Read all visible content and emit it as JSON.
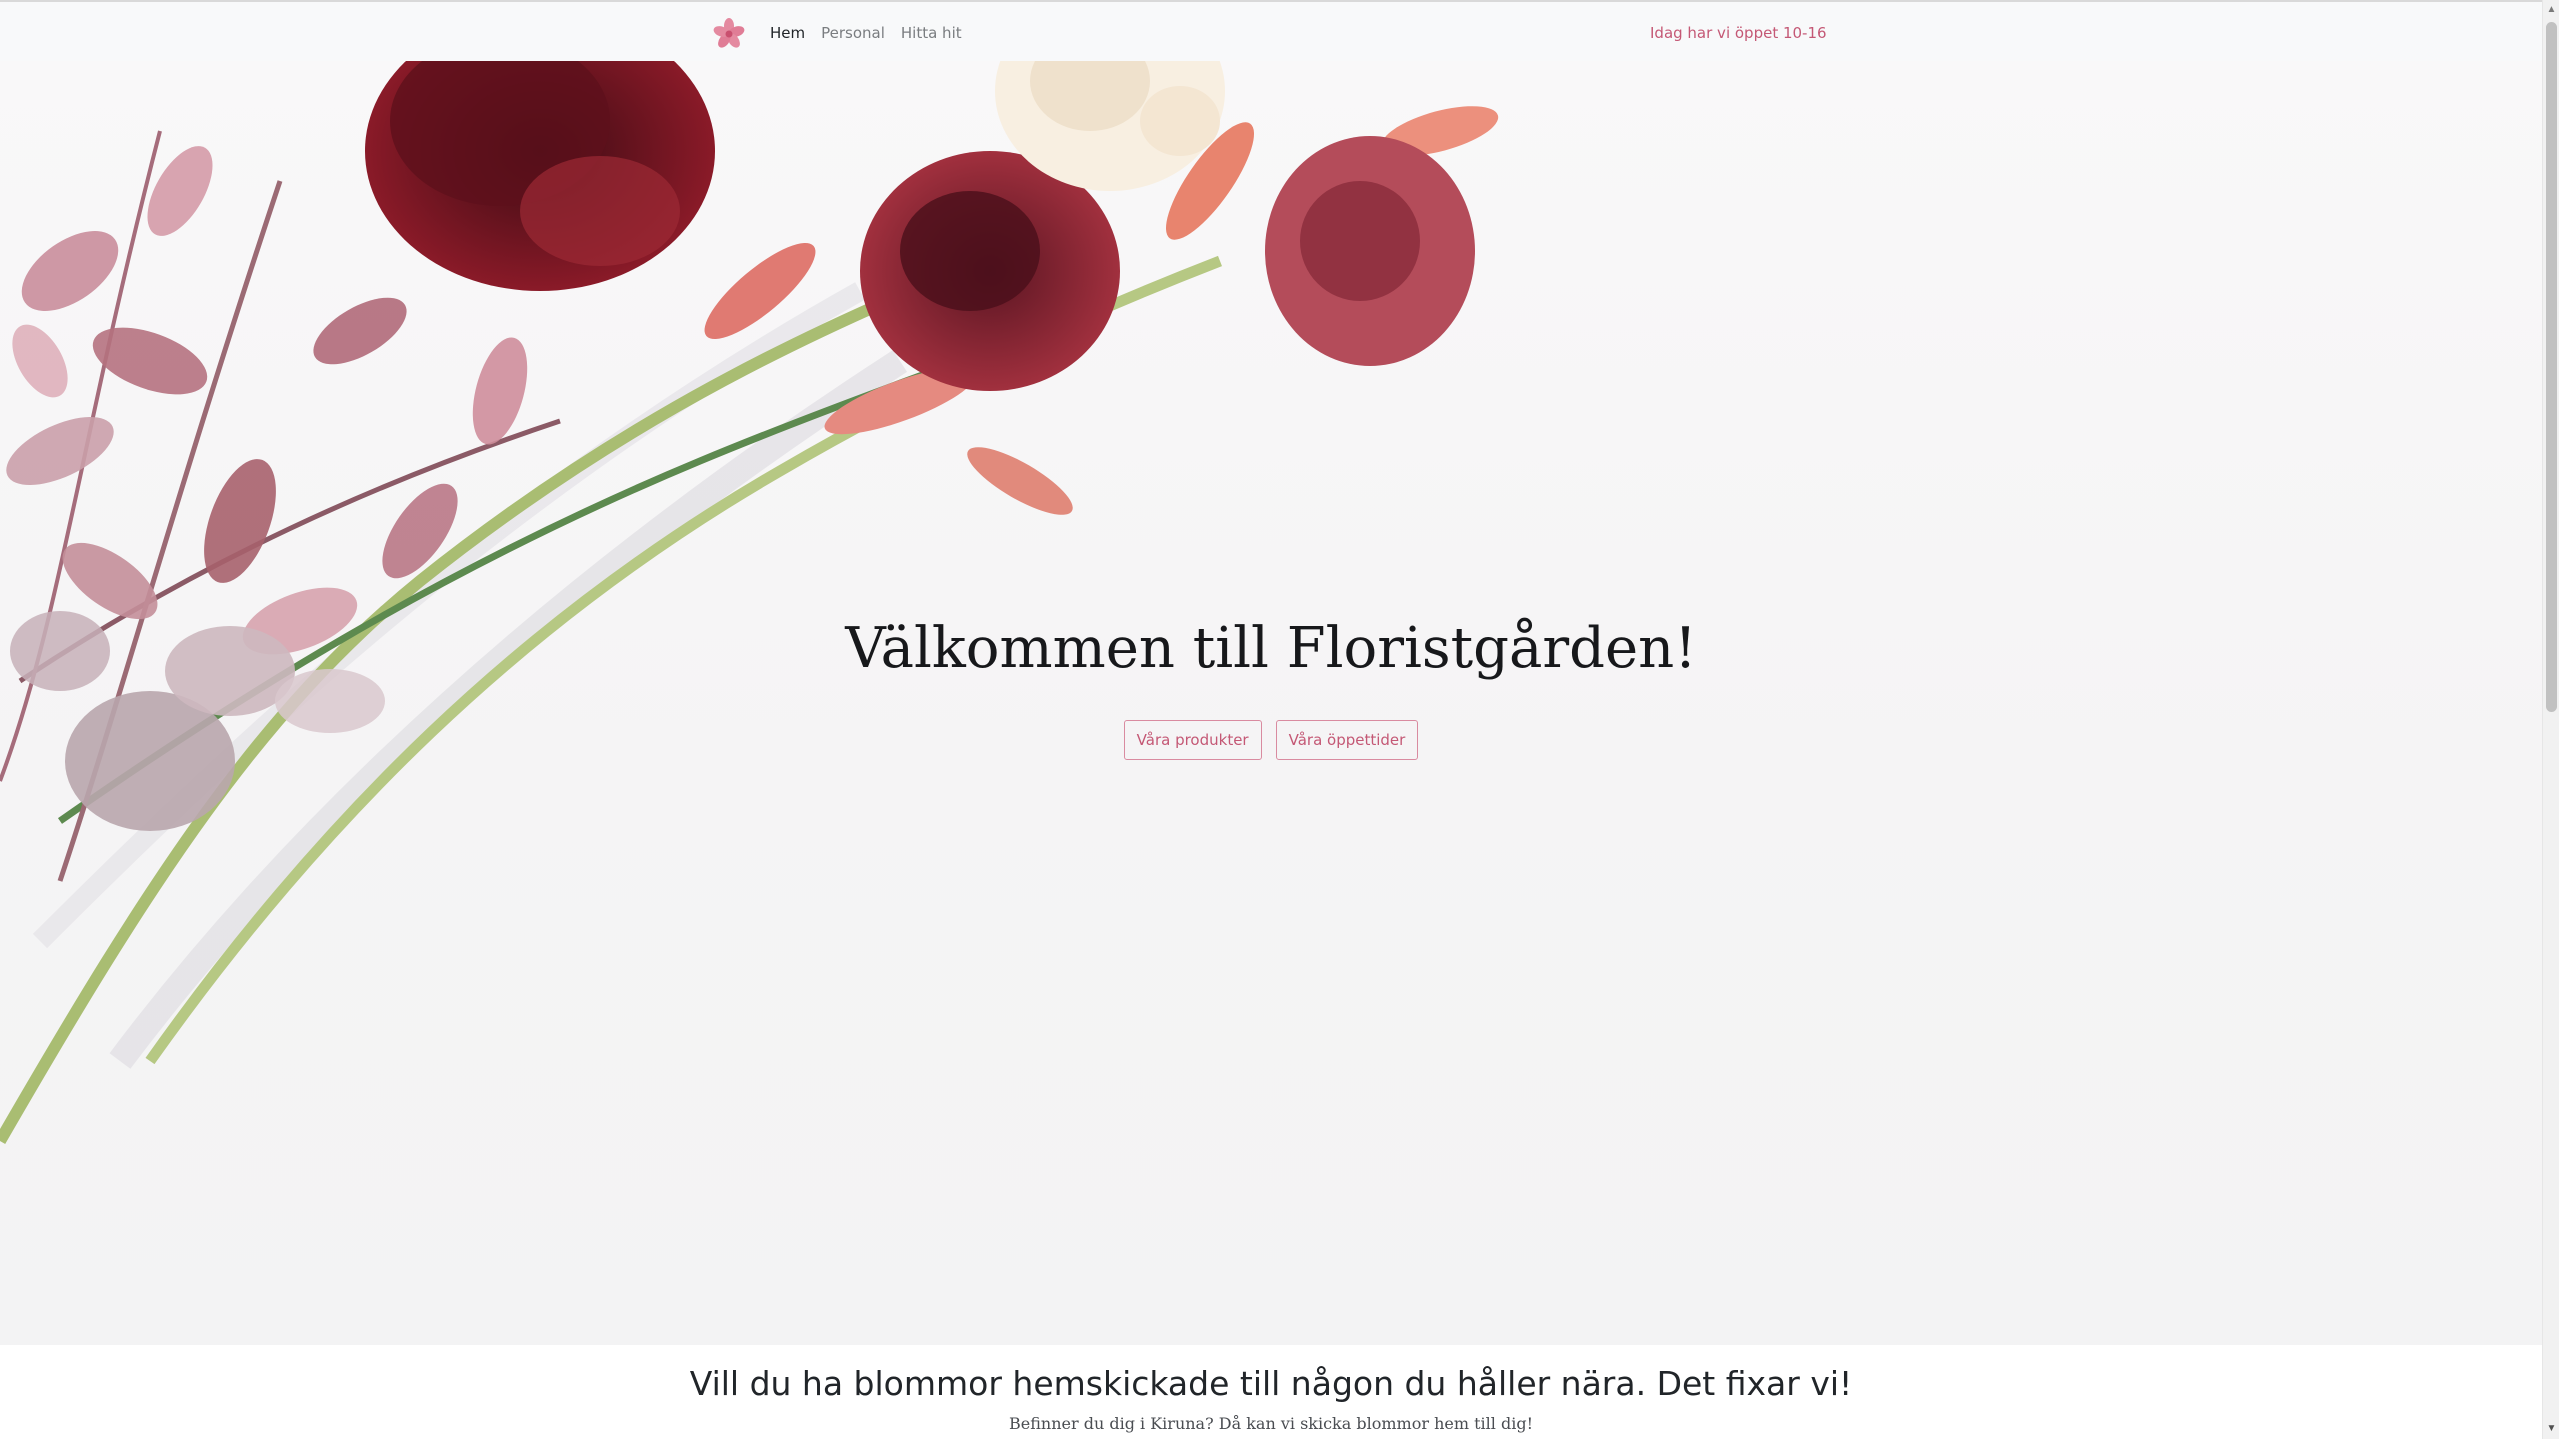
{
  "nav": {
    "brand_icon": "flower-icon",
    "links": [
      {
        "label": "Hem",
        "active": true
      },
      {
        "label": "Personal",
        "active": false
      },
      {
        "label": "Hitta hit",
        "active": false
      }
    ],
    "status": "Idag har vi öppet 10-16"
  },
  "hero": {
    "title": "Välkommen till Floristgården!",
    "buttons": [
      "Våra produkter",
      "Våra öppettider"
    ]
  },
  "info": {
    "heading": "Vill du ha blommor hemskickade till någon du håller nära. Det fixar vi!",
    "text": "Befinner du dig i Kiruna? Då kan vi skicka blommor hem till dig!"
  },
  "colors": {
    "accent": "#c45875",
    "navbar_bg": "#f8f9fa",
    "hero_bg": "#f5f4f5",
    "text_dark": "#212529"
  }
}
